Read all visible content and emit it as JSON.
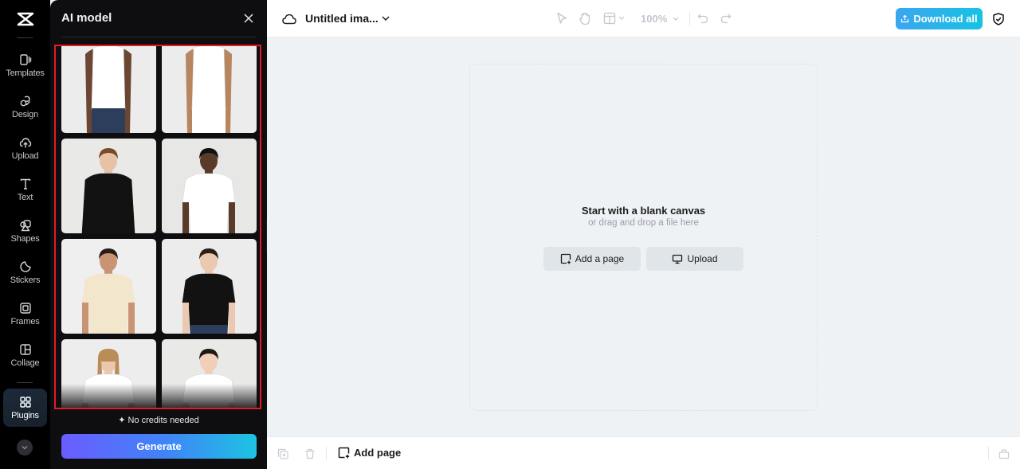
{
  "app": {
    "logo": "capcut-logo"
  },
  "rail": {
    "items": [
      {
        "label": "Templates",
        "icon": "templates-icon"
      },
      {
        "label": "Design",
        "icon": "design-icon"
      },
      {
        "label": "Upload",
        "icon": "upload-cloud-icon"
      },
      {
        "label": "Text",
        "icon": "text-icon"
      },
      {
        "label": "Shapes",
        "icon": "shapes-icon"
      },
      {
        "label": "Stickers",
        "icon": "sticker-icon"
      },
      {
        "label": "Frames",
        "icon": "frames-icon"
      },
      {
        "label": "Collage",
        "icon": "collage-icon"
      },
      {
        "label": "Plugins",
        "icon": "plugins-icon",
        "active": true
      }
    ],
    "more_icon": "chevron-down-icon"
  },
  "panel": {
    "title": "AI model",
    "close_icon": "close-icon",
    "models": [
      {
        "desc": "Woman in white sleeveless mock-neck top with jeans",
        "shirt": "#ffffff",
        "skin": "#6b4632",
        "hair": "#1a1210",
        "bg": "#ececec"
      },
      {
        "desc": "Woman in white tank top",
        "shirt": "#ffffff",
        "skin": "#b7855e",
        "hair": "#3a2416",
        "bg": "#ececec"
      },
      {
        "desc": "Man in black long-sleeve sweater",
        "shirt": "#121212",
        "skin": "#e7c2a6",
        "hair": "#7a4a2a",
        "bg": "#e9e9e7"
      },
      {
        "desc": "Man in white t-shirt",
        "shirt": "#ffffff",
        "skin": "#5a3a28",
        "hair": "#111111",
        "bg": "#e7e7e5"
      },
      {
        "desc": "Man in beige t-shirt",
        "shirt": "#f2e6cc",
        "skin": "#c89474",
        "hair": "#2a1d16",
        "bg": "#efefef"
      },
      {
        "desc": "Man in black t-shirt with jeans",
        "shirt": "#121212",
        "skin": "#ebc8b0",
        "hair": "#2a2018",
        "bg": "#ececec"
      },
      {
        "desc": "Woman in white t-shirt",
        "shirt": "#ffffff",
        "skin": "#eac7ad",
        "hair": "#b98c58",
        "bg": "#ededed"
      },
      {
        "desc": "Young man in white t-shirt",
        "shirt": "#ffffff",
        "skin": "#efcfba",
        "hair": "#1f1812",
        "bg": "#e9e9e8"
      }
    ],
    "credits_text": "✦ No credits needed",
    "generate_label": "Generate"
  },
  "topbar": {
    "cloud_icon": "cloud-icon",
    "doc_title": "Untitled ima...",
    "zoom_level": "100%",
    "download_label": "Download all",
    "shield_icon": "shield-check-icon"
  },
  "canvas": {
    "title": "Start with a blank canvas",
    "subtitle": "or drag and drop a file here",
    "add_page_label": "Add a page",
    "upload_label": "Upload"
  },
  "bottombar": {
    "add_page_label": "Add page"
  },
  "colors": {
    "highlight_border": "#e31b23",
    "download_gradient": [
      "#3aa6f0",
      "#17c2e2"
    ],
    "generate_gradient": [
      "#6a5cff",
      "#3f86f7",
      "#1cc4e2"
    ]
  }
}
